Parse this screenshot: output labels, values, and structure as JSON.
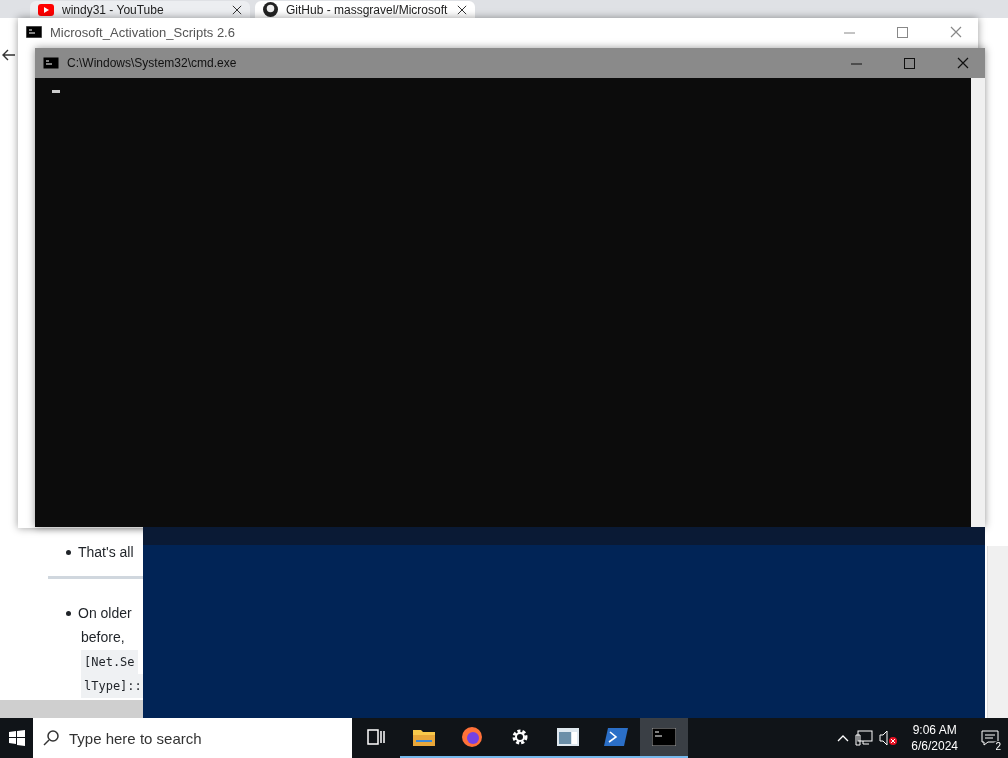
{
  "browser": {
    "tabs": [
      {
        "title": "windy31 - YouTube",
        "selected": false
      },
      {
        "title": "GitHub - massgravel/Microsoft",
        "selected": true
      }
    ],
    "page": [
      {
        "kind": "bullet",
        "text": "That's all"
      },
      {
        "kind": "rule"
      },
      {
        "kind": "bullet",
        "text": "On older"
      },
      {
        "kind": "text",
        "text": "before,"
      },
      {
        "kind": "code",
        "text": "[Net.Se"
      },
      {
        "kind": "code",
        "text": "lType]::"
      }
    ]
  },
  "mas_window": {
    "title": "Microsoft_Activation_Scripts 2.6"
  },
  "cmd_window": {
    "title": "C:\\Windows\\System32\\cmd.exe"
  },
  "taskbar": {
    "search": {
      "placeholder": "Type here to search"
    },
    "apps": [
      {
        "kind": "taskview",
        "running": false,
        "active": false
      },
      {
        "kind": "folder",
        "running": true,
        "active": false
      },
      {
        "kind": "firefox",
        "running": true,
        "active": false
      },
      {
        "kind": "settings",
        "running": true,
        "active": false
      },
      {
        "kind": "window",
        "running": true,
        "active": false
      },
      {
        "kind": "powershell",
        "running": true,
        "active": false
      },
      {
        "kind": "terminal",
        "running": true,
        "active": true
      }
    ],
    "clock": {
      "time": "9:06 AM",
      "date": "6/6/2024"
    },
    "notifications": "2"
  }
}
